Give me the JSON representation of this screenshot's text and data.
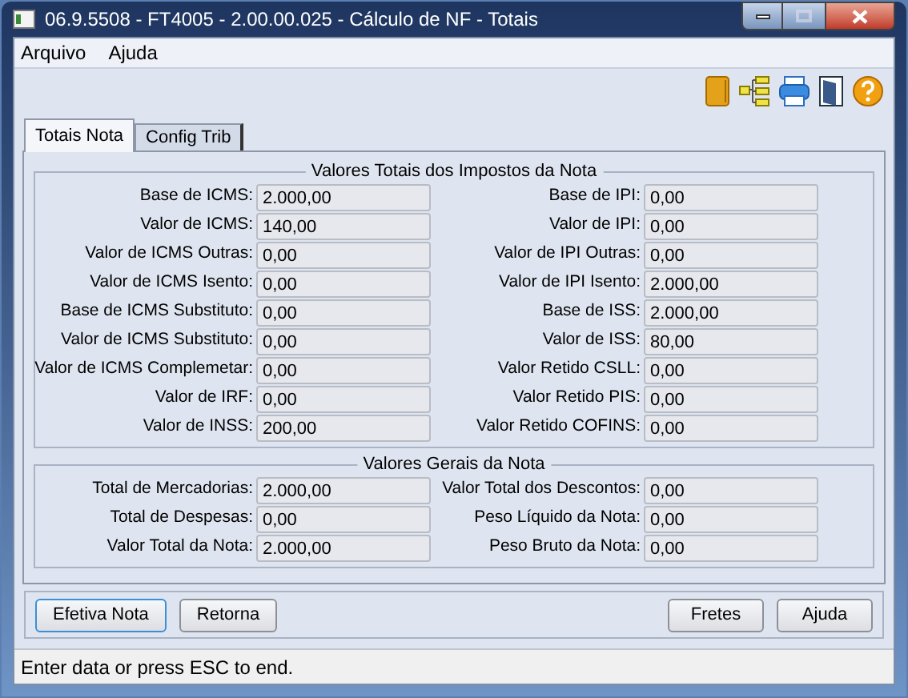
{
  "window": {
    "title": "06.9.5508 - FT4005 - 2.00.00.025 - Cálculo de NF - Totais"
  },
  "menu": [
    "Arquivo",
    "Ajuda"
  ],
  "tabs": [
    {
      "label": "Totais Nota",
      "selected": true
    },
    {
      "label": "Config Trib",
      "selected": false
    }
  ],
  "groups": [
    {
      "title": "Valores Totais dos Impostos da Nota",
      "left": [
        {
          "label": "Base de ICMS:",
          "value": "2.000,00"
        },
        {
          "label": "Valor de ICMS:",
          "value": "140,00"
        },
        {
          "label": "Valor de ICMS Outras:",
          "value": "0,00"
        },
        {
          "label": "Valor de ICMS Isento:",
          "value": "0,00"
        },
        {
          "label": "Base de ICMS Substituto:",
          "value": "0,00"
        },
        {
          "label": "Valor de ICMS Substituto:",
          "value": "0,00"
        },
        {
          "label": "Valor de ICMS Complemetar:",
          "value": "0,00"
        },
        {
          "label": "Valor de IRF:",
          "value": "0,00"
        },
        {
          "label": "Valor de INSS:",
          "value": "200,00"
        }
      ],
      "right": [
        {
          "label": "Base de IPI:",
          "value": "0,00"
        },
        {
          "label": "Valor de IPI:",
          "value": "0,00"
        },
        {
          "label": "Valor de IPI Outras:",
          "value": "0,00"
        },
        {
          "label": "Valor de IPI Isento:",
          "value": "2.000,00"
        },
        {
          "label": "Base de ISS:",
          "value": "2.000,00"
        },
        {
          "label": "Valor de ISS:",
          "value": "80,00"
        },
        {
          "label": "Valor Retido CSLL:",
          "value": "0,00"
        },
        {
          "label": "Valor Retido PIS:",
          "value": "0,00"
        },
        {
          "label": "Valor Retido COFINS:",
          "value": "0,00"
        }
      ]
    },
    {
      "title": "Valores Gerais da Nota",
      "left": [
        {
          "label": "Total de Mercadorias:",
          "value": "2.000,00"
        },
        {
          "label": "Total de Despesas:",
          "value": "0,00"
        },
        {
          "label": "Valor Total da Nota:",
          "value": "2.000,00"
        }
      ],
      "right": [
        {
          "label": "Valor Total dos Descontos:",
          "value": "0,00"
        },
        {
          "label": "Peso Líquido da Nota:",
          "value": "0,00"
        },
        {
          "label": "Peso Bruto da Nota:",
          "value": "0,00"
        }
      ]
    }
  ],
  "buttons_left": [
    {
      "label": "Efetiva Nota",
      "default": true
    },
    {
      "label": "Retorna",
      "default": false
    }
  ],
  "buttons_right": [
    {
      "label": "Fretes",
      "default": false
    },
    {
      "label": "Ajuda",
      "default": false
    }
  ],
  "status_bar": "Enter data or press ESC to end."
}
